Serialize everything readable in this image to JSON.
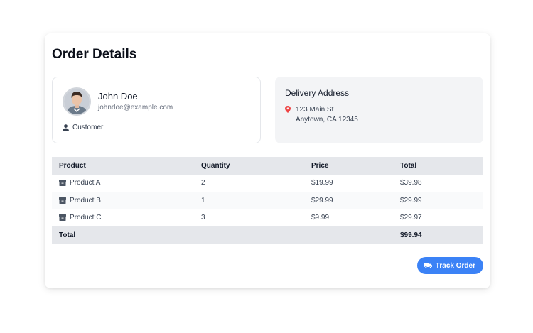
{
  "page": {
    "title": "Order Details"
  },
  "customer": {
    "name": "John Doe",
    "email": "johndoe@example.com",
    "role": "Customer",
    "role_icon": "user-icon",
    "avatar_icon": "avatar-photo"
  },
  "delivery": {
    "title": "Delivery Address",
    "icon": "map-marker-icon",
    "icon_color": "#ef4444",
    "line1": "123 Main St",
    "line2": "Anytown, CA 12345"
  },
  "table": {
    "headers": [
      "Product",
      "Quantity",
      "Price",
      "Total"
    ],
    "row_icon": "box-icon",
    "rows": [
      {
        "product": "Product A",
        "quantity": "2",
        "price": "$19.99",
        "total": "$39.98"
      },
      {
        "product": "Product B",
        "quantity": "1",
        "price": "$29.99",
        "total": "$29.99"
      },
      {
        "product": "Product C",
        "quantity": "3",
        "price": "$9.99",
        "total": "$29.97"
      }
    ],
    "footer": {
      "label": "Total",
      "value": "$99.94"
    }
  },
  "actions": {
    "track_label": "Track Order",
    "track_icon": "truck-icon",
    "accent": "#3b82f6"
  }
}
